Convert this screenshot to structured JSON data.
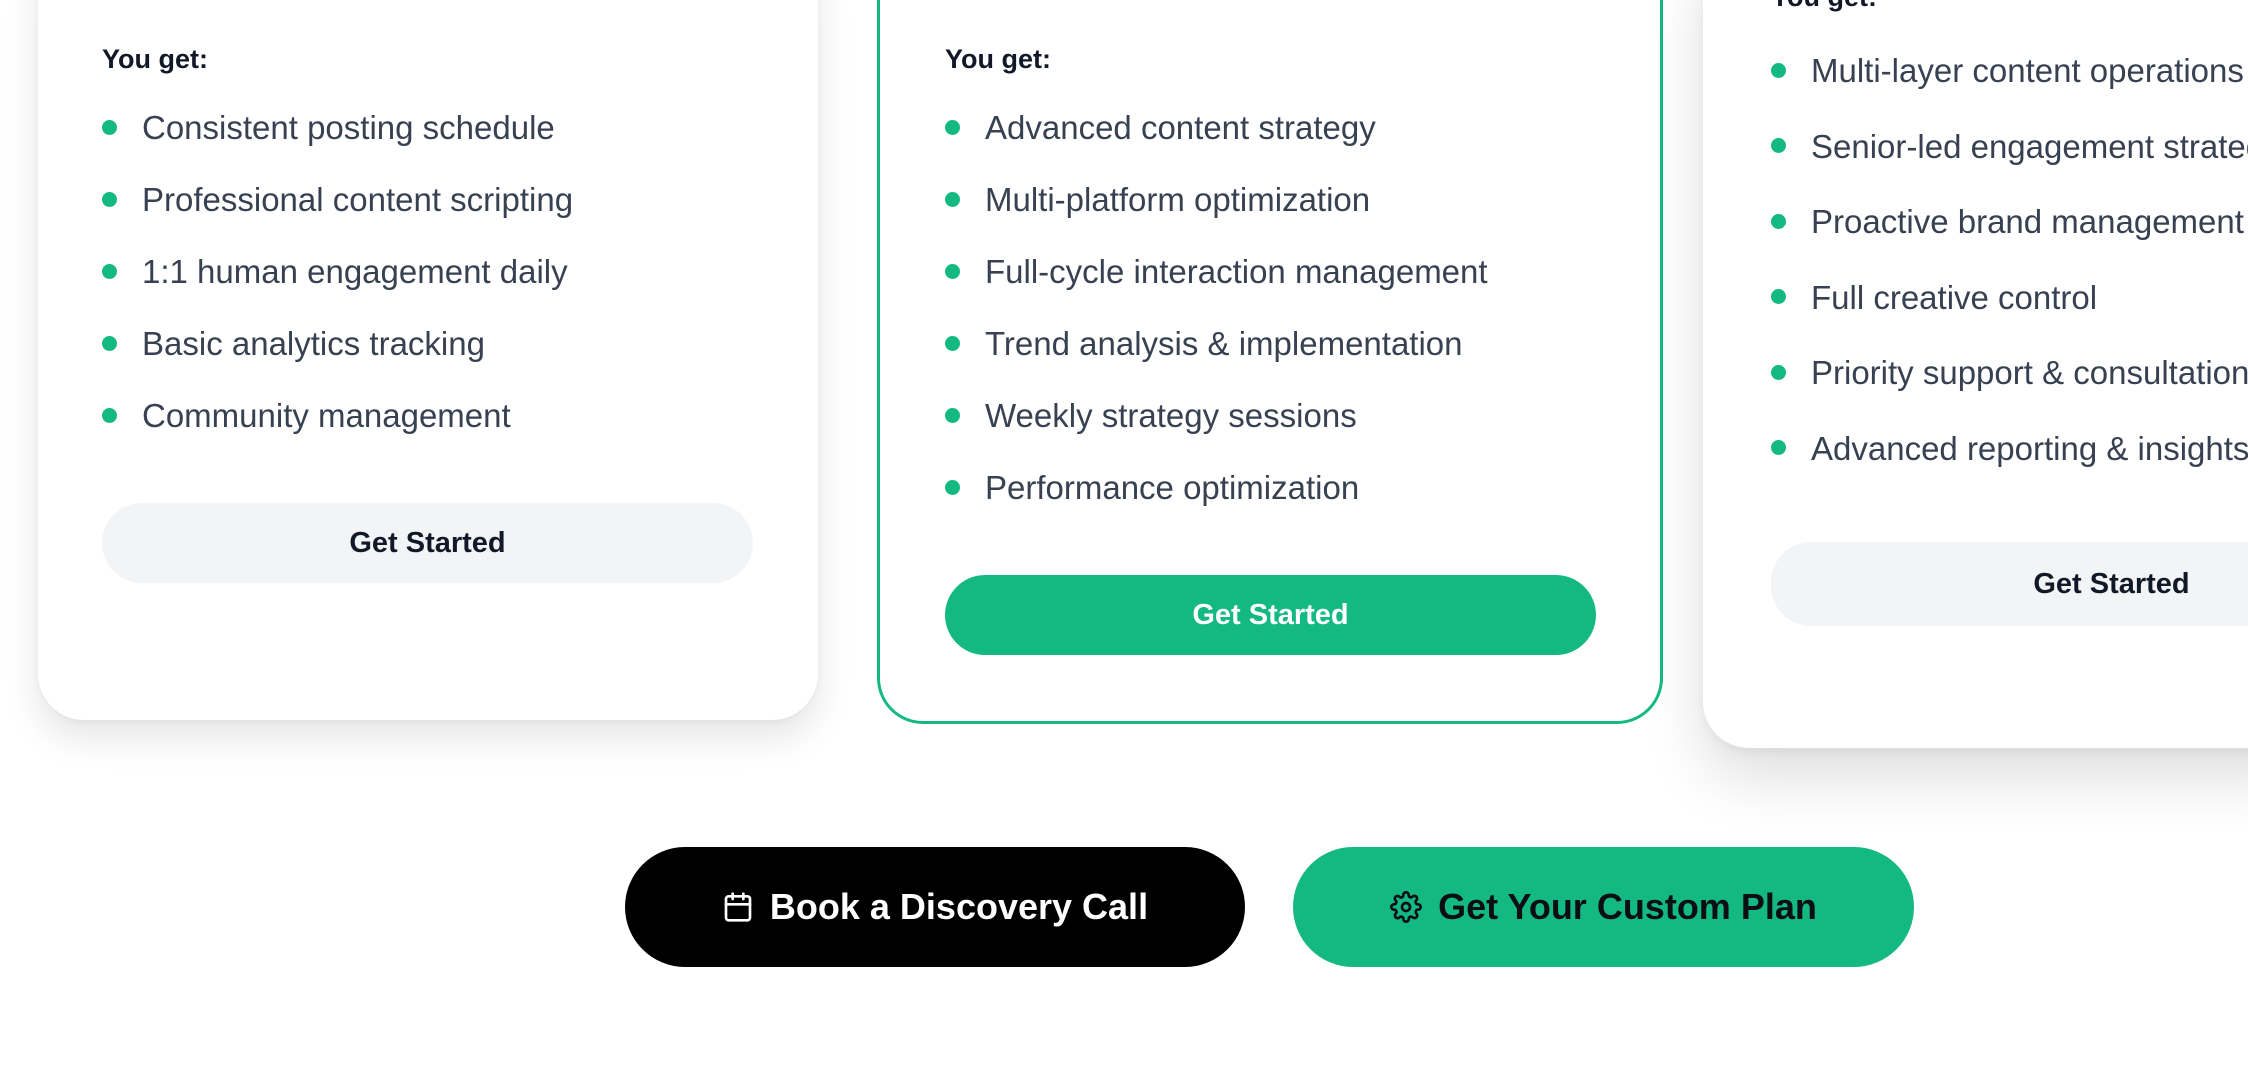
{
  "colors": {
    "accent": "#14b981",
    "dark": "#000000",
    "text": "#374151"
  },
  "plans": [
    {
      "you_get_label": "You get:",
      "features": [
        "Consistent posting schedule",
        "Professional content scripting",
        "1:1 human engagement daily",
        "Basic analytics tracking",
        "Community management"
      ],
      "button_label": "Get Started"
    },
    {
      "you_get_label": "You get:",
      "features": [
        "Advanced content strategy",
        "Multi-platform optimization",
        "Full-cycle interaction management",
        "Trend analysis & implementation",
        "Weekly strategy sessions",
        "Performance optimization"
      ],
      "button_label": "Get Started"
    },
    {
      "you_get_label": "You get:",
      "features": [
        "Multi-layer content operations",
        "Senior-led engagement strategy",
        "Proactive brand management",
        "Full creative control",
        "Priority support & consultation",
        "Advanced reporting & insights"
      ],
      "button_label": "Get Started"
    }
  ],
  "cta": {
    "discovery_call": {
      "label": "Book a Discovery Call",
      "icon": "calendar-icon"
    },
    "custom_plan": {
      "label": "Get Your Custom Plan",
      "icon": "gear-icon"
    }
  }
}
